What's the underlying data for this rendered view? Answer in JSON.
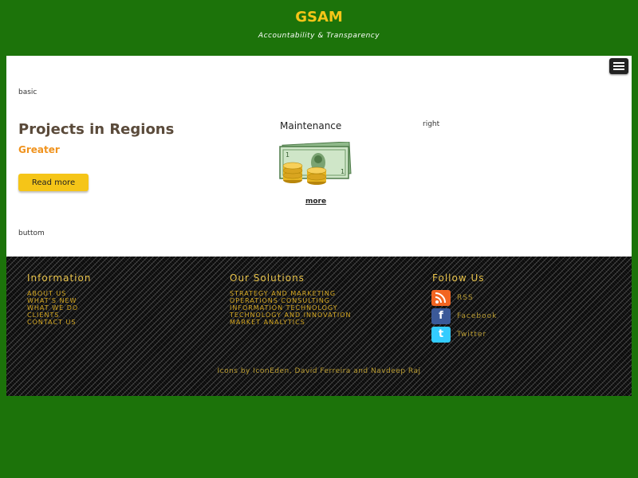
{
  "header": {
    "title": "GSAM",
    "tagline": "Accountability & Transparency"
  },
  "positions": {
    "basic": "basic",
    "right": "right",
    "buttom": "buttom"
  },
  "projects": {
    "title": "Projects in Regions",
    "subtitle": "Greater",
    "button": "Read more"
  },
  "maintenance": {
    "title": "Maintenance",
    "image_icon": "money-bills-coins-icon",
    "more": "more"
  },
  "footer": {
    "information": {
      "title": "Information",
      "links": [
        "ABOUT US",
        "WHAT'S NEW",
        "WHAT WE DO",
        "CLIENTS",
        "CONTACT US"
      ]
    },
    "solutions": {
      "title": "Our Solutions",
      "links": [
        "STRATEGY AND MARKETING",
        "OPERATIONS CONSULTING",
        "INFORMATION TECHNOLOGY",
        "TECHNOLOGY AND INNOVATION",
        "MARKET ANALYTICS"
      ]
    },
    "follow": {
      "title": "Follow Us",
      "items": [
        {
          "label": "RSS",
          "icon": "rss-icon",
          "color": "#f26522"
        },
        {
          "label": "Facebook",
          "icon": "facebook-icon",
          "color": "#3b5998"
        },
        {
          "label": "Twitter",
          "icon": "twitter-icon",
          "color": "#33ccff"
        }
      ]
    },
    "credits": {
      "prefix": "Icons by ",
      "a1": "IconEden",
      "sep": ", ",
      "a2": "David Ferreira",
      "and": " and ",
      "a3": "Navdeep Raj"
    }
  },
  "colors": {
    "background": "#1c730a",
    "accent": "#f5c518",
    "subtitle": "#f0931e"
  }
}
